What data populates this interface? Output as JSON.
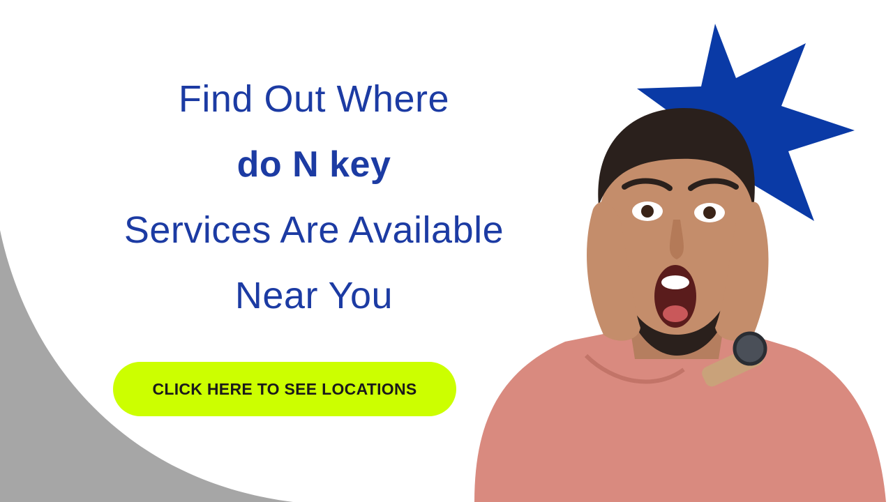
{
  "headline": {
    "line1": "Find Out Where",
    "line2": "do N key",
    "line3": "Services Are Available",
    "line4": "Near You"
  },
  "cta": {
    "label": "CLICK HERE TO SEE LOCATIONS"
  },
  "colors": {
    "headline": "#1c3ba3",
    "cta_background": "#ccff00",
    "burst": "#0a3aa6",
    "background_curve": "#a6a6a6",
    "sweater": "#d98a7f"
  },
  "icons": {
    "burst": "starburst-icon"
  }
}
